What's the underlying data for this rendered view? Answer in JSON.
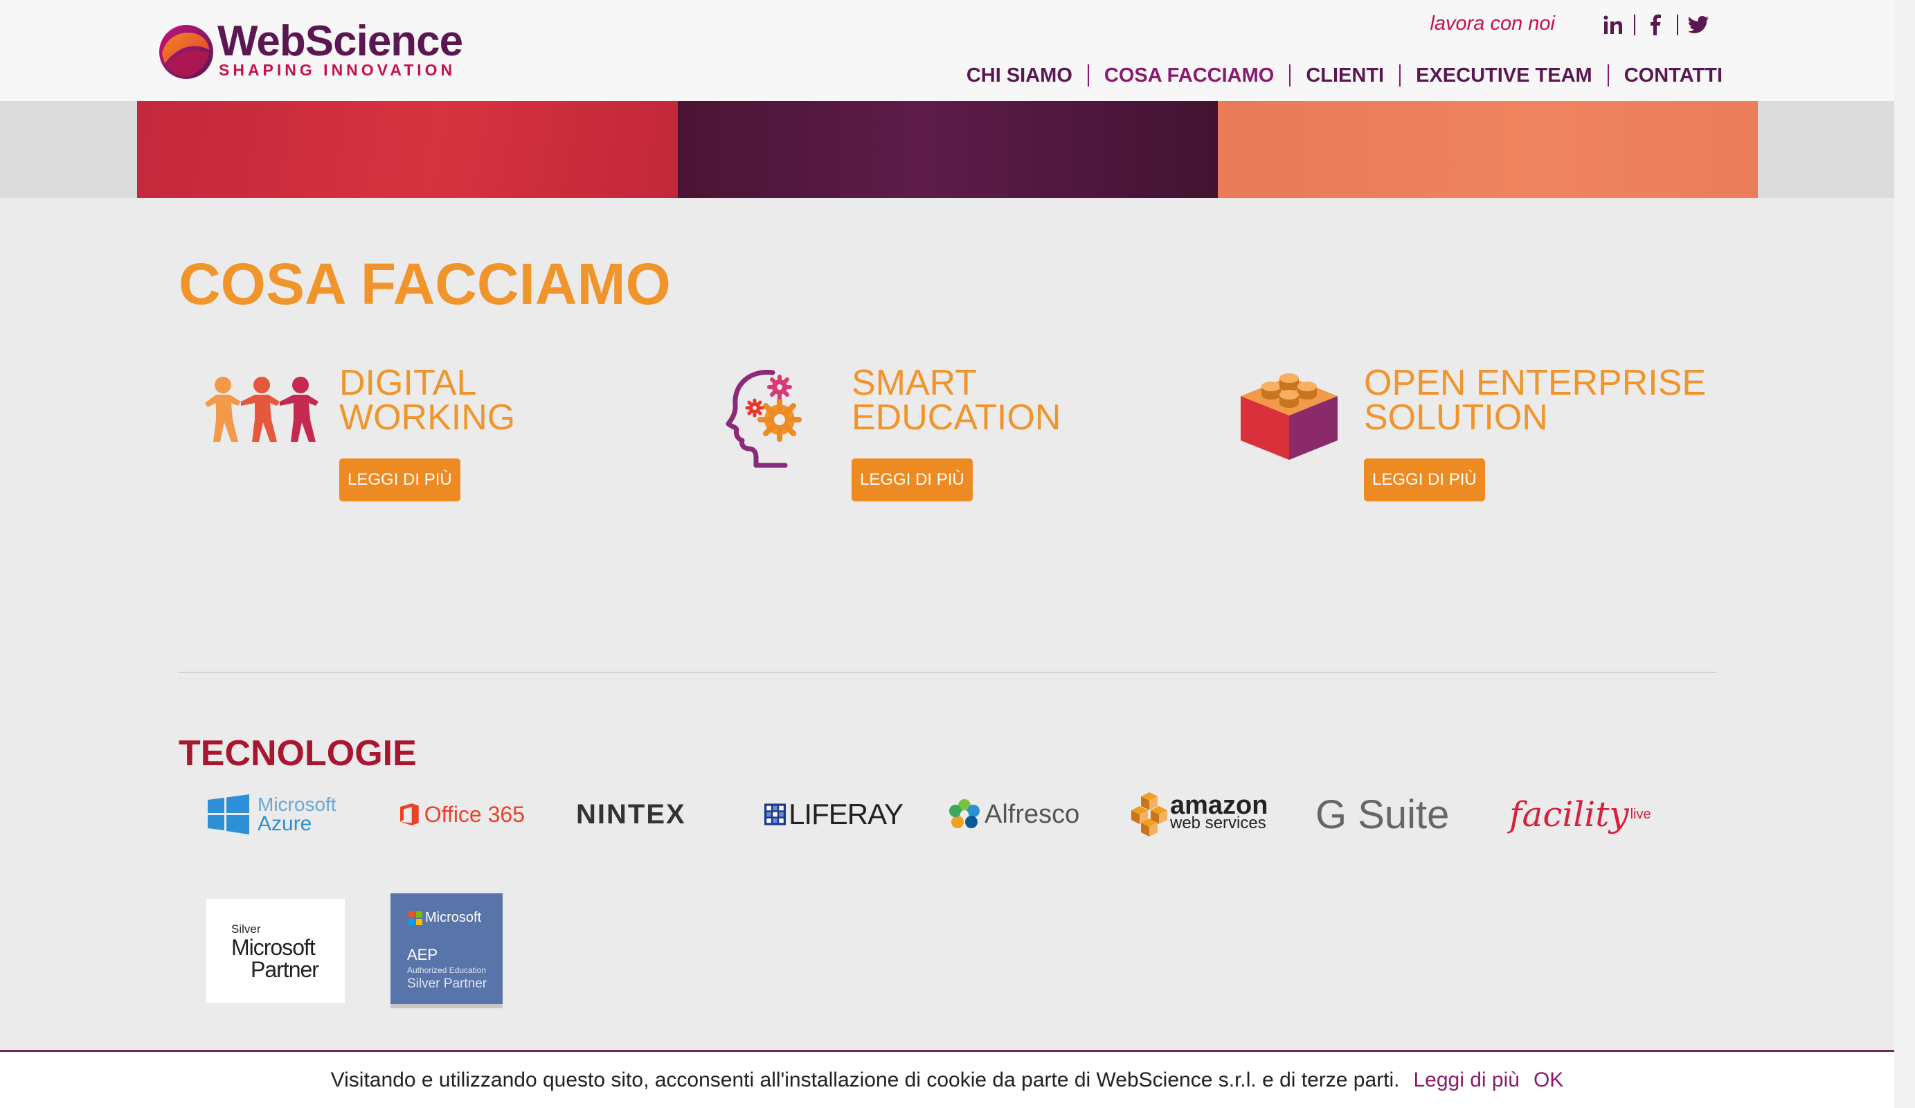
{
  "header": {
    "logo": {
      "title": "WebScience",
      "subtitle": "SHAPING INNOVATION"
    },
    "work_link": "lavora con noi",
    "social": [
      {
        "name": "linkedin",
        "icon": "linkedin-icon",
        "label": "in"
      },
      {
        "name": "facebook",
        "icon": "facebook-icon",
        "label": "f"
      },
      {
        "name": "twitter",
        "icon": "twitter-icon",
        "label": ""
      }
    ],
    "nav": [
      {
        "label": "CHI SIAMO",
        "active": false
      },
      {
        "label": "COSA FACCIAMO",
        "active": true
      },
      {
        "label": "CLIENTI",
        "active": false
      },
      {
        "label": "EXECUTIVE TEAM",
        "active": false
      },
      {
        "label": "CONTATTI",
        "active": false
      }
    ]
  },
  "main": {
    "title": "COSA FACCIAMO",
    "services": [
      {
        "icon": "people-chain-icon",
        "title_line1": "DIGITAL",
        "title_line2": "WORKING",
        "button": "LEGGI DI PIÙ"
      },
      {
        "icon": "head-gears-icon",
        "title_line1": "SMART",
        "title_line2": "EDUCATION",
        "button": "LEGGI DI PIÙ"
      },
      {
        "icon": "lego-brick-icon",
        "title_line1": "OPEN ENTERPRISE",
        "title_line2": "SOLUTION",
        "button": "LEGGI DI PIÙ"
      }
    ]
  },
  "technologies": {
    "title": "TECNOLOGIE",
    "logos": [
      {
        "name": "microsoft-azure",
        "line1": "Microsoft",
        "line2": "Azure"
      },
      {
        "name": "office-365",
        "text": "Office 365"
      },
      {
        "name": "nintex",
        "text": "NINTEX"
      },
      {
        "name": "liferay",
        "text": "LIFERAY"
      },
      {
        "name": "alfresco",
        "text": "Alfresco"
      },
      {
        "name": "amazon-web-services",
        "line1": "amazon",
        "line2": "web services"
      },
      {
        "name": "g-suite",
        "text": "G Suite"
      },
      {
        "name": "facility-live",
        "text": "facility",
        "suffix": "live"
      }
    ],
    "badges": {
      "silver_partner": {
        "line1": "Silver",
        "line2": "Microsoft",
        "line3": "Partner"
      },
      "aep": {
        "brand": "Microsoft",
        "line1": "AEP",
        "line2": "Authorized Education",
        "line3": "Silver Partner"
      }
    }
  },
  "cookie_bar": {
    "message": "Visitando e utilizzando questo sito, acconsenti all'installazione di cookie da parte di WebScience s.r.l. e di terze parti.",
    "more_link": "Leggi di più",
    "ok": "OK"
  },
  "colors": {
    "brand_purple": "#5a1752",
    "accent_orange": "#f0952c",
    "button_orange": "#ee8a22",
    "tech_red": "#a8162f",
    "italic_red": "#c4124a"
  }
}
